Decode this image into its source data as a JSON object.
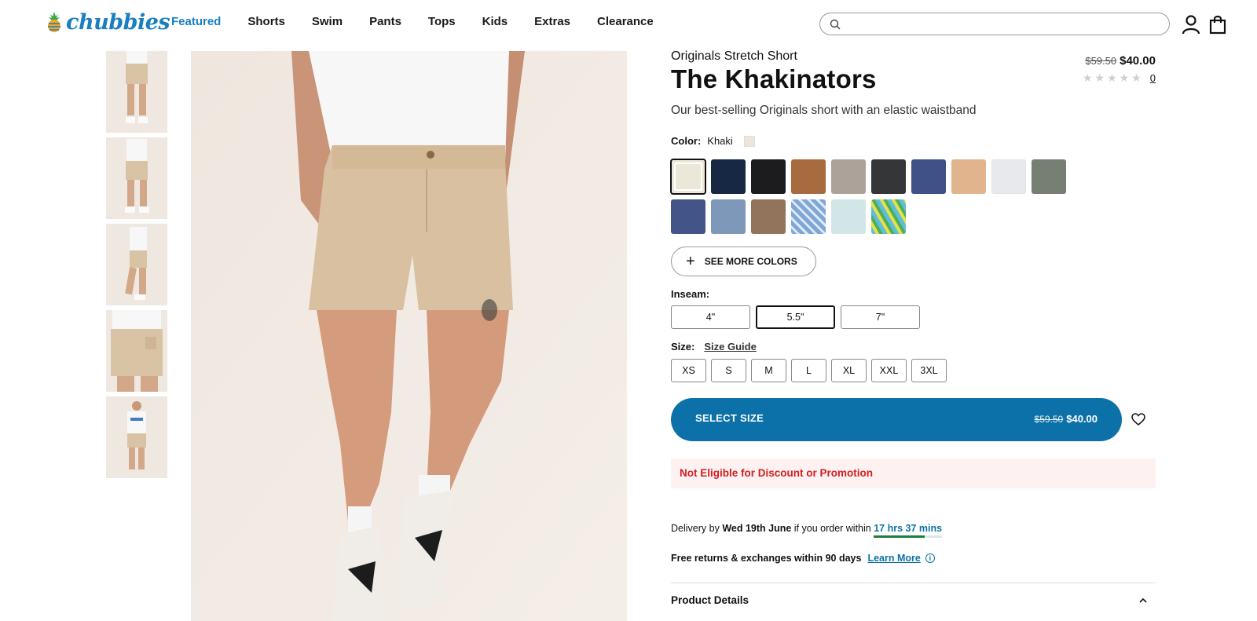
{
  "brand": {
    "name": "chubbies"
  },
  "nav": {
    "items": [
      {
        "label": "Featured",
        "active": true
      },
      {
        "label": "Shorts"
      },
      {
        "label": "Swim"
      },
      {
        "label": "Pants"
      },
      {
        "label": "Tops"
      },
      {
        "label": "Kids"
      },
      {
        "label": "Extras"
      },
      {
        "label": "Clearance"
      }
    ]
  },
  "search": {
    "placeholder": "",
    "value": ""
  },
  "header_icons": [
    "search-icon",
    "account-icon",
    "cart-bag-icon"
  ],
  "product": {
    "subtitle": "Originals Stretch Short",
    "title": "The Khakinators",
    "old_price": "$59.50",
    "price": "$40.00",
    "rating_count": "0",
    "tagline": "Our best-selling Originals short with an elastic waistband",
    "color_label": "Color:",
    "color_value": "Khaki",
    "swatches": [
      {
        "name": "Khaki",
        "color": "#ece7d8",
        "selected": true
      },
      {
        "name": "Navy",
        "color": "#162844"
      },
      {
        "name": "Black",
        "color": "#1c1c1e"
      },
      {
        "name": "Rust",
        "color": "#a86a3f"
      },
      {
        "name": "Taupe",
        "color": "#ada29a"
      },
      {
        "name": "Charcoal",
        "color": "#343638"
      },
      {
        "name": "Blue",
        "color": "#3f5187"
      },
      {
        "name": "Sand",
        "color": "#e1b48d"
      },
      {
        "name": "White",
        "color": "#e8e9ed"
      },
      {
        "name": "Sage",
        "color": "#777e73"
      },
      {
        "name": "Denim",
        "color": "#435488"
      },
      {
        "name": "Slate Blue",
        "color": "#7d98b9"
      },
      {
        "name": "Brown",
        "color": "#92745c"
      },
      {
        "name": "Blue Floral",
        "color": "#7ea6d6"
      },
      {
        "name": "Mint",
        "color": "#d2e5e7"
      },
      {
        "name": "Tropical",
        "color": "#5dbedb"
      }
    ],
    "see_more_colors": "SEE MORE COLORS",
    "inseam_label": "Inseam:",
    "inseams": [
      {
        "label": "4\"",
        "selected": false
      },
      {
        "label": "5.5\"",
        "selected": true
      },
      {
        "label": "7\"",
        "selected": false
      }
    ],
    "size_label": "Size:",
    "size_guide": "Size Guide",
    "sizes": [
      "XS",
      "S",
      "M",
      "L",
      "XL",
      "XXL",
      "3XL"
    ],
    "select_button": "SELECT SIZE",
    "not_eligible": "Not Eligible for Discount or Promotion",
    "delivery": {
      "prefix": "Delivery by",
      "date": "Wed 19th June",
      "middle": "if you order within",
      "countdown": "17 hrs 37 mins",
      "countdown_progress": 0.74
    },
    "returns": "Free returns & exchanges within 90 days",
    "learn_more": "Learn More",
    "details_label": "Product Details"
  },
  "colors": {
    "accent": "#0b71a8",
    "brand": "#1a7fc1",
    "alert": "#d12020",
    "alert_bg": "#fdf1f1"
  }
}
